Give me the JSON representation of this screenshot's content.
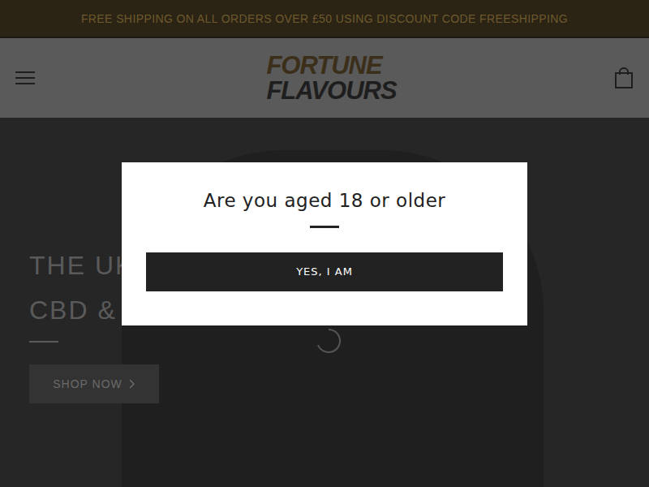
{
  "announcement": "FREE SHIPPING ON ALL ORDERS OVER £50 USING DISCOUNT CODE FREESHIPPING",
  "header": {
    "logo": {
      "line1": "FORTUNE",
      "line2": "FLAVOURS"
    }
  },
  "hero": {
    "headline": [
      "THE UK",
      "CBD & C"
    ],
    "button": "SHOP NOW"
  },
  "modal": {
    "title": "Are you aged 18 or older",
    "button": "YES, I AM"
  }
}
